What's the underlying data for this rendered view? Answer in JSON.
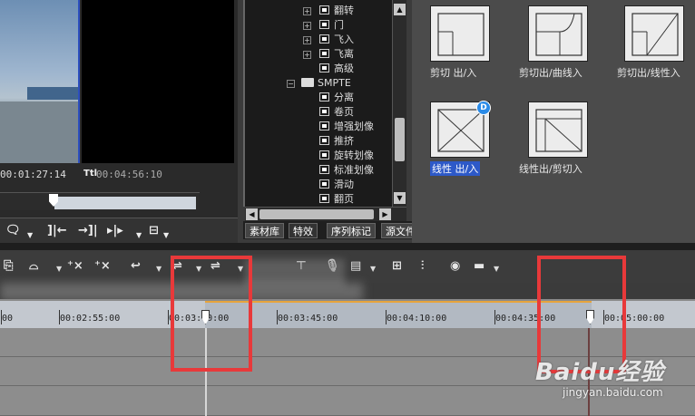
{
  "preview": {
    "current_timecode": "00:01:27:14",
    "total_label": "Ttl",
    "total_timecode": "00:04:56:10"
  },
  "tree": {
    "items": [
      {
        "label": "翻转",
        "expandable": true
      },
      {
        "label": "门",
        "expandable": true
      },
      {
        "label": "飞入",
        "expandable": true
      },
      {
        "label": "飞离",
        "expandable": true
      },
      {
        "label": "高级",
        "expandable": false
      },
      {
        "label": "SMPTE",
        "expandable": true,
        "folder": true
      },
      {
        "label": "分离",
        "expandable": false
      },
      {
        "label": "卷页",
        "expandable": false
      },
      {
        "label": "增强划像",
        "expandable": false
      },
      {
        "label": "推挤",
        "expandable": false
      },
      {
        "label": "旋转划像",
        "expandable": false
      },
      {
        "label": "标准划像",
        "expandable": false
      },
      {
        "label": "滑动",
        "expandable": false
      },
      {
        "label": "翻页",
        "expandable": false
      }
    ]
  },
  "tabs": [
    {
      "label": "素材库",
      "active": false
    },
    {
      "label": "特效",
      "active": true
    },
    {
      "label": "序列标记",
      "active": false
    },
    {
      "label": "源文件浏览",
      "active": false
    }
  ],
  "effects": [
    {
      "label": "剪切 出/入",
      "selected": false
    },
    {
      "label": "剪切出/曲线入",
      "selected": false
    },
    {
      "label": "剪切出/线性入",
      "selected": false
    },
    {
      "label": "线性 出/入",
      "selected": true,
      "badge": "D"
    },
    {
      "label": "线性出/剪切入",
      "selected": false
    }
  ],
  "ruler": {
    "ticks": [
      "00",
      "00:02:55:00",
      "00:03:00:00",
      "00:03:45:00",
      "00:04:10:00",
      "00:04:35:00",
      "00:05:00:00"
    ]
  },
  "watermark": {
    "logo": "Baidu经验",
    "url": "jingyan.baidu.com"
  },
  "colors": {
    "annotation_red": "#e8393a",
    "selection_blue": "#2d59c8",
    "in_out_orange": "#e6a43c"
  }
}
